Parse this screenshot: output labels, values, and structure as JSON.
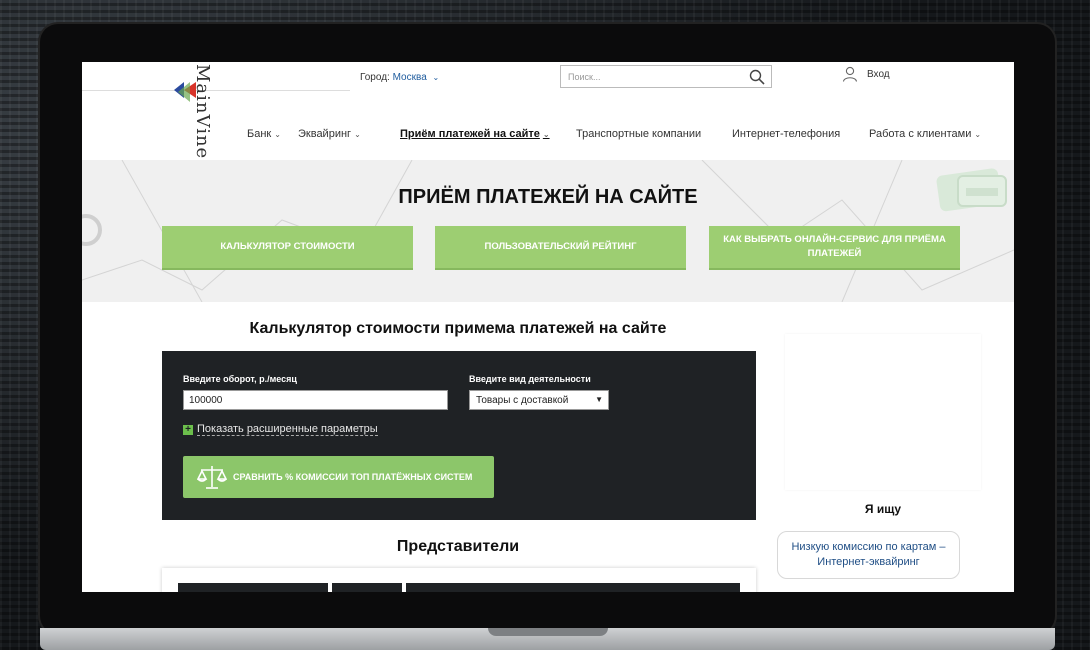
{
  "header": {
    "city_label": "Город:",
    "city_value": "Москва",
    "search_placeholder": "Поиск...",
    "login_label": "Вход",
    "logo_text": "MainVine"
  },
  "nav": {
    "items": [
      {
        "label": "Банк",
        "has_dropdown": true
      },
      {
        "label": "Эквайринг",
        "has_dropdown": true
      },
      {
        "label": "Приём платежей на сайте",
        "has_dropdown": true,
        "active": true
      },
      {
        "label": "Транспортные компании",
        "has_dropdown": false
      },
      {
        "label": "Интернет-телефония",
        "has_dropdown": false
      },
      {
        "label": "Работа с клиентами",
        "has_dropdown": true
      }
    ]
  },
  "hero": {
    "title": "ПРИЁМ ПЛАТЕЖЕЙ НА САЙТЕ",
    "buttons": [
      {
        "label": "КАЛЬКУЛЯТОР СТОИМОСТИ"
      },
      {
        "label": "ПОЛЬЗОВАТЕЛЬСКИЙ РЕЙТИНГ"
      },
      {
        "label": "КАК ВЫБРАТЬ ОНЛАЙН-СЕРВИС ДЛЯ ПРИЁМА ПЛАТЕЖЕЙ"
      }
    ]
  },
  "calculator": {
    "title": "Калькулятор стоимости примема платежей на сайте",
    "turnover_label": "Введите оборот, р./месяц",
    "turnover_value": "100000",
    "activity_label": "Введите вид деятельности",
    "activity_value": "Товары с доставкой",
    "advanced_link": "Показать расширенные параметры",
    "compare_button": "СРАВНИТЬ % КОМИССИИ ТОП ПЛАТЁЖНЫХ СИСТЕМ"
  },
  "representatives": {
    "title": "Представители"
  },
  "sidebar": {
    "seek_title": "Я ищу",
    "seek_button": "Низкую комиссию по картам – Интернет-эквайринг"
  },
  "colors": {
    "accent_green": "#9dce72",
    "dark_panel": "#1f2225",
    "link_blue": "#1f5c9e"
  }
}
